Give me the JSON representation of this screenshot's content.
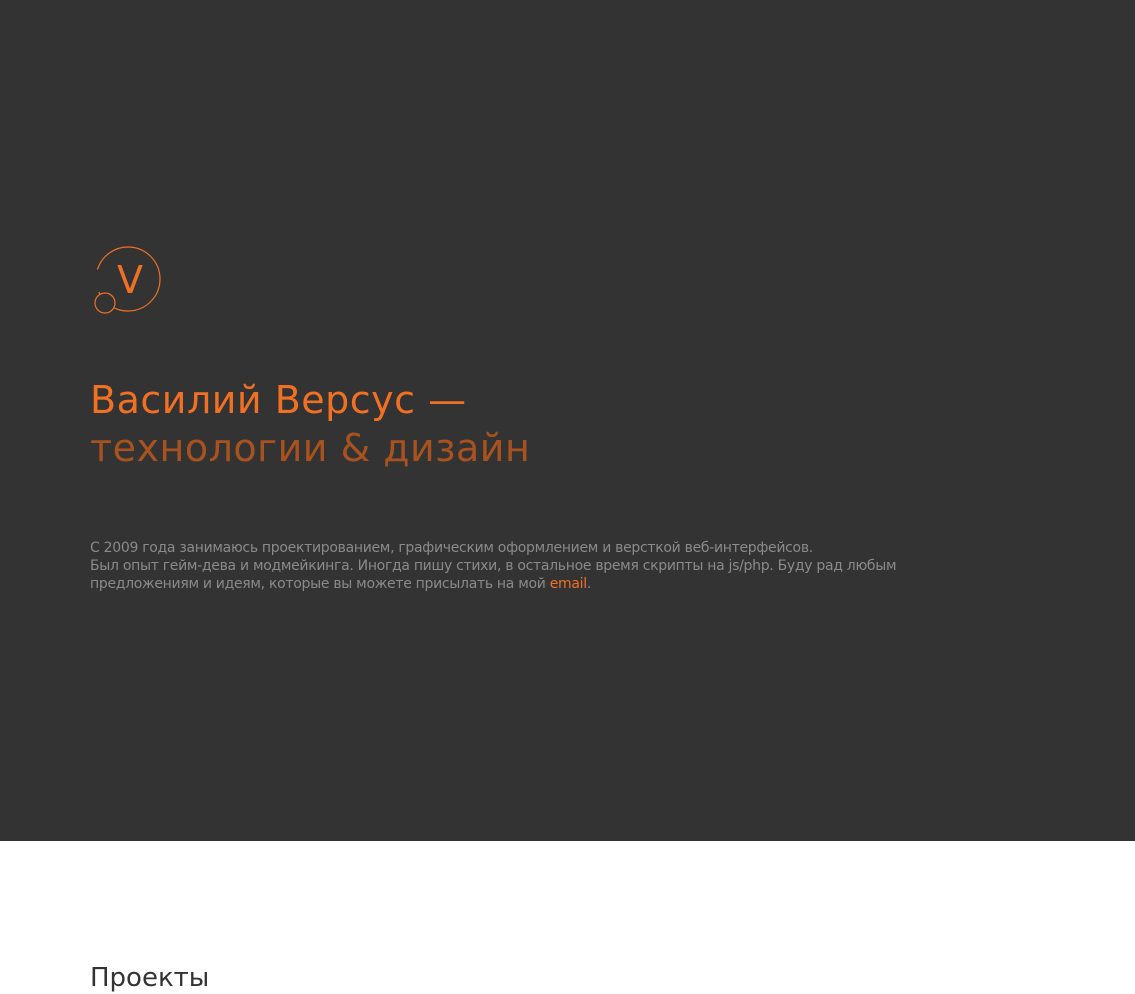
{
  "brand": {
    "logo_letter": "V",
    "accent_color": "#f07024"
  },
  "hero": {
    "title_line1": "Василий Версус —",
    "title_line2": "технологии & дизайн",
    "bio_line1": "С 2009 года занимаюсь проектированием, графическим оформлением и версткой веб-интерфейсов.",
    "bio_line2": "Был опыт гейм-дева и модмейкинга. Иногда пишу стихи, в остальное время скрипты на js/php. Буду рад любым",
    "bio_line3_prefix": "предложениям и идеям, которые вы можете присылать на мой ",
    "bio_link": "email",
    "bio_line3_suffix": "."
  },
  "projects": {
    "heading": "Проекты"
  }
}
